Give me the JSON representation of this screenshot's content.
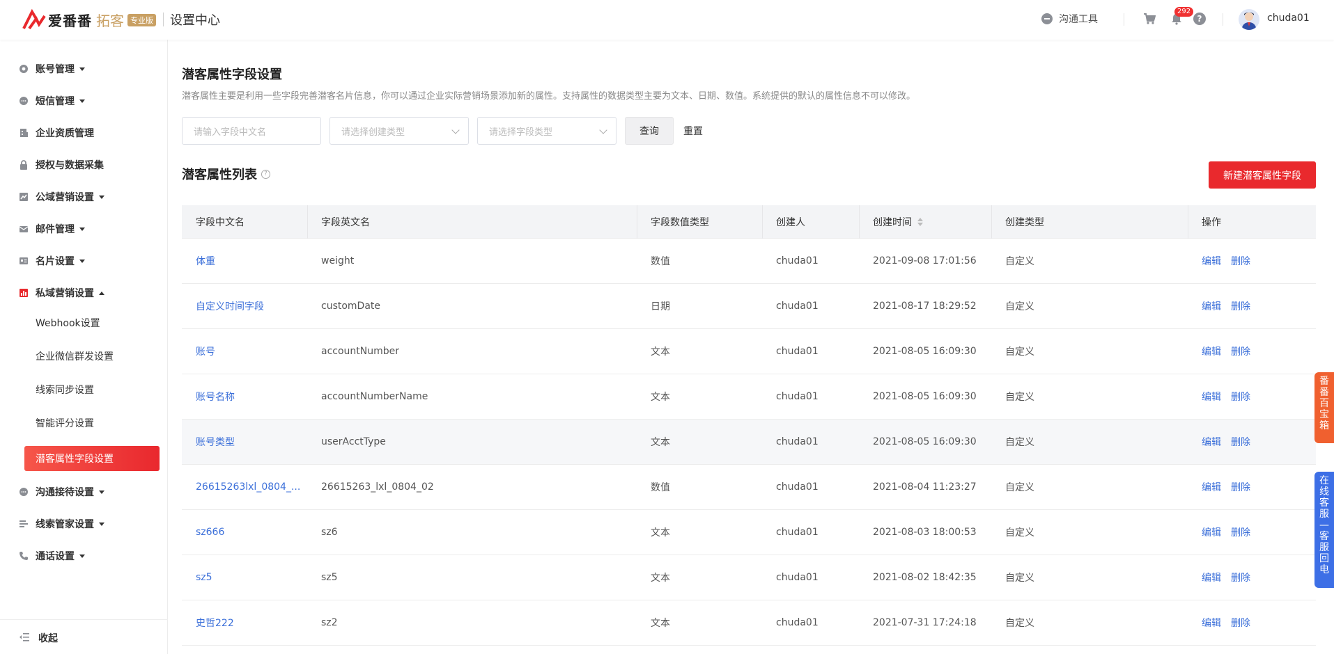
{
  "header": {
    "brand": "爱番番",
    "product": "拓客",
    "edition_badge": "专业版",
    "section_title": "设置中心",
    "tool_label": "沟通工具",
    "notification_count": "292",
    "username": "chuda01"
  },
  "sidebar": {
    "items": [
      {
        "label": "账号管理",
        "icon": "gear-icon"
      },
      {
        "label": "短信管理",
        "icon": "message-icon"
      },
      {
        "label": "企业资质管理",
        "icon": "building-icon"
      },
      {
        "label": "授权与数据采集",
        "icon": "lock-icon"
      },
      {
        "label": "公域营销设置",
        "icon": "chart-icon"
      },
      {
        "label": "邮件管理",
        "icon": "mail-icon"
      },
      {
        "label": "名片设置",
        "icon": "card-icon"
      },
      {
        "label": "私域营销设置",
        "icon": "bar-chart-icon"
      },
      {
        "label": "沟通接待设置",
        "icon": "chat-icon"
      },
      {
        "label": "线索管家设置",
        "icon": "list-icon"
      },
      {
        "label": "通话设置",
        "icon": "phone-icon"
      }
    ],
    "sub_items": [
      {
        "label": "Webhook设置"
      },
      {
        "label": "企业微信群发设置"
      },
      {
        "label": "线索同步设置"
      },
      {
        "label": "智能评分设置"
      },
      {
        "label": "潜客属性字段设置"
      }
    ],
    "collapse_label": "收起"
  },
  "main": {
    "title": "潜客属性字段设置",
    "description": "潜客属性主要是利用一些字段完善潜客名片信息，你可以通过企业实际营销场景添加新的属性。支持属性的数据类型主要为文本、日期、数值。系统提供的默认的属性信息不可以修改。",
    "filters": {
      "name_placeholder": "请输入字段中文名",
      "create_type_placeholder": "请选择创建类型",
      "field_type_placeholder": "请选择字段类型",
      "query_label": "查询",
      "reset_label": "重置"
    },
    "list_title": "潜客属性列表",
    "new_button": "新建潜客属性字段",
    "table": {
      "headers": [
        "字段中文名",
        "字段英文名",
        "字段数值类型",
        "创建人",
        "创建时间",
        "创建类型",
        "操作"
      ],
      "edit_label": "编辑",
      "delete_label": "删除",
      "rows": [
        {
          "cn": "体重",
          "en": "weight",
          "type": "数值",
          "creator": "chuda01",
          "time": "2021-09-08 17:01:56",
          "ctype": "自定义"
        },
        {
          "cn": "自定义时间字段",
          "en": "customDate",
          "type": "日期",
          "creator": "chuda01",
          "time": "2021-08-17 18:29:52",
          "ctype": "自定义"
        },
        {
          "cn": "账号",
          "en": "accountNumber",
          "type": "文本",
          "creator": "chuda01",
          "time": "2021-08-05 16:09:30",
          "ctype": "自定义"
        },
        {
          "cn": "账号名称",
          "en": "accountNumberName",
          "type": "文本",
          "creator": "chuda01",
          "time": "2021-08-05 16:09:30",
          "ctype": "自定义"
        },
        {
          "cn": "账号类型",
          "en": "userAcctType",
          "type": "文本",
          "creator": "chuda01",
          "time": "2021-08-05 16:09:30",
          "ctype": "自定义"
        },
        {
          "cn": "26615263lxl_0804_...",
          "en": "26615263_lxl_0804_02",
          "type": "数值",
          "creator": "chuda01",
          "time": "2021-08-04 11:23:27",
          "ctype": "自定义"
        },
        {
          "cn": "sz666",
          "en": "sz6",
          "type": "文本",
          "creator": "chuda01",
          "time": "2021-08-03 18:00:53",
          "ctype": "自定义"
        },
        {
          "cn": "sz5",
          "en": "sz5",
          "type": "文本",
          "creator": "chuda01",
          "time": "2021-08-02 18:42:35",
          "ctype": "自定义"
        },
        {
          "cn": "史哲222",
          "en": "sz2",
          "type": "文本",
          "creator": "chuda01",
          "time": "2021-07-31 17:24:18",
          "ctype": "自定义"
        }
      ]
    }
  },
  "float_tabs": {
    "box": [
      "番",
      "番",
      "百",
      "宝",
      "箱"
    ],
    "service": [
      "在",
      "线",
      "客",
      "服",
      "—",
      "客",
      "服",
      "回",
      "电"
    ]
  },
  "colors": {
    "accent_red": "#e9292d",
    "link_blue": "#3b6fd9",
    "brand_gold": "#c9a063",
    "service_blue": "#3d6fe6",
    "box_orange": "#f0602f"
  }
}
